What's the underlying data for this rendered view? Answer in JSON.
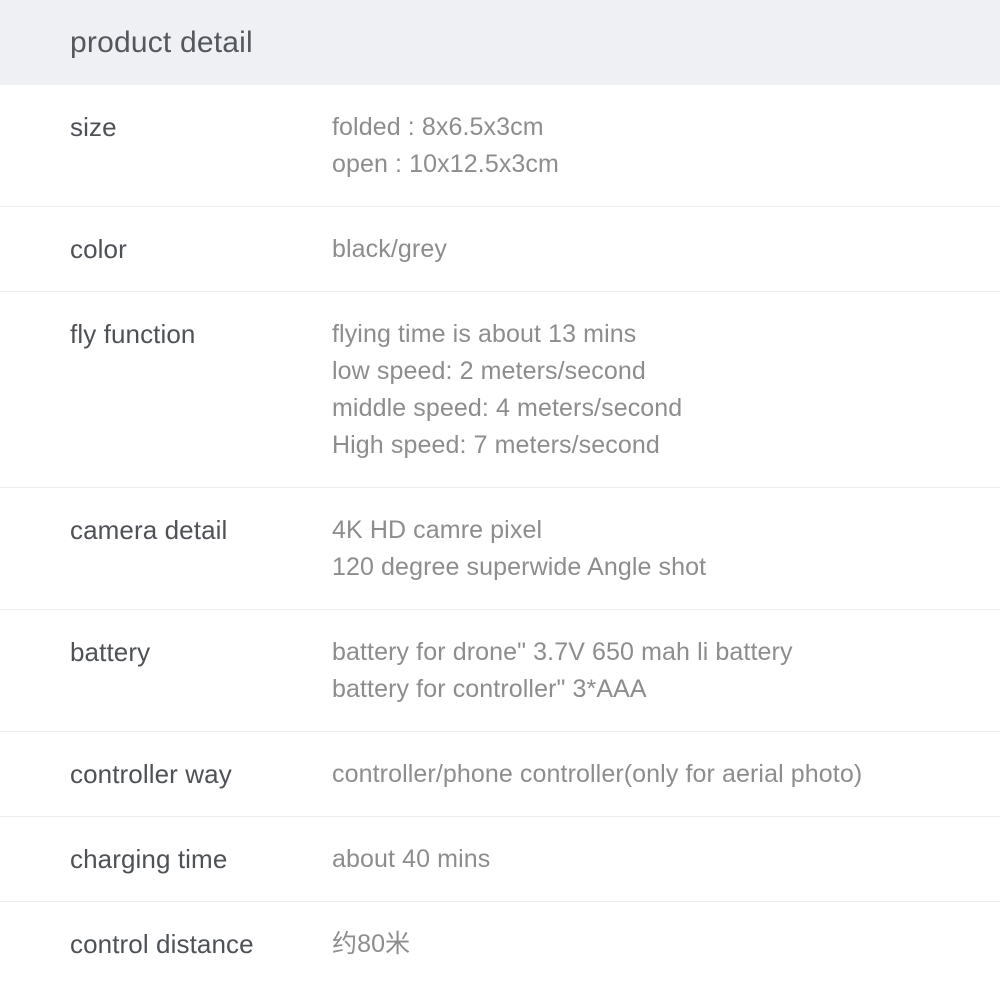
{
  "header": {
    "title": "product detail",
    "background_color": "#eef0f4",
    "text_color": "#54585e"
  },
  "theme": {
    "page_background": "#ffffff",
    "divider_color": "#ececec",
    "label_color": "#4e5156",
    "value_color": "#8d8d8d"
  },
  "spec_table": {
    "rows": [
      {
        "label": "size",
        "values": [
          "folded : 8x6.5x3cm",
          "open : 10x12.5x3cm"
        ]
      },
      {
        "label": "color",
        "values": [
          "black/grey"
        ]
      },
      {
        "label": "fly function",
        "values": [
          "flying time is about 13 mins",
          "low speed: 2 meters/second",
          "middle speed: 4 meters/second",
          "High speed: 7 meters/second"
        ]
      },
      {
        "label": "camera detail",
        "values": [
          "4K HD camre pixel",
          "120 degree superwide Angle shot"
        ]
      },
      {
        "label": "battery",
        "values": [
          "battery for drone\" 3.7V 650 mah li battery",
          "battery for controller\" 3*AAA"
        ]
      },
      {
        "label": "controller way",
        "values": [
          "controller/phone controller(only for aerial photo)"
        ]
      },
      {
        "label": "charging time",
        "values": [
          "about 40 mins"
        ]
      },
      {
        "label": "control distance",
        "values": [
          "约80米"
        ]
      }
    ]
  }
}
